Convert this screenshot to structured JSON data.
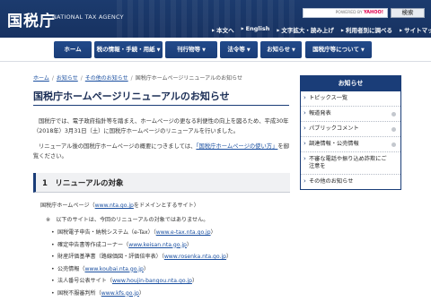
{
  "header": {
    "logo": "国税庁",
    "agency": "NATIONAL TAX AGENCY",
    "search": {
      "powered": "POWERED BY",
      "brand": "YAHOO!",
      "button": "検索"
    },
    "utility": [
      "本文へ",
      "English",
      "文字拡大・読み上げ",
      "利用者別に調べる",
      "サイトマップ"
    ]
  },
  "nav": [
    {
      "label": "ホーム",
      "has_dropdown": false
    },
    {
      "label": "税の情報・手続・用紙",
      "has_dropdown": true
    },
    {
      "label": "刊行物等",
      "has_dropdown": true
    },
    {
      "label": "法令等",
      "has_dropdown": true
    },
    {
      "label": "お知らせ",
      "has_dropdown": true
    },
    {
      "label": "国税庁等について",
      "has_dropdown": true
    }
  ],
  "breadcrumb": [
    "ホーム",
    "お知らせ",
    "その他のお知らせ",
    "国税庁ホームページリニューアルのお知らせ"
  ],
  "page_title": "国税庁ホームページリニューアルのお知らせ",
  "intro": {
    "p1": "国税庁では、電子政府指針等を踏まえ、ホームページの更なる利便性の向上を図るため、平成30年（2018年）3月31日（土）に国税庁ホームページのリニューアルを行いました。",
    "p2_before": "リニューアル後の国税庁ホームページの概要につきましては、",
    "p2_link": "「国税庁ホームページの使い方」",
    "p2_after": "を御覧ください。"
  },
  "section1": {
    "heading": "1　リニューアルの対象",
    "line1_before": "国税庁ホームページ（",
    "line1_link": "www.nta.go.jp",
    "line1_after": "をドメインとするサイト）",
    "note": "※　以下のサイトは、今回のリニューアルの対象ではありません。",
    "sites": [
      {
        "name": "国税電子申告・納税システム（e-Tax）",
        "url": "www.e-tax.nta.go.jp"
      },
      {
        "name": "確定申告書等作成コーナー",
        "url": "www.keisan.nta.go.jp"
      },
      {
        "name": "財産評価基準書（路線価図・評価倍率表）",
        "url": "www.rosenka.nta.go.jp"
      },
      {
        "name": "公売情報",
        "url": "www.koubai.nta.go.jp"
      },
      {
        "name": "法人番号公表サイト",
        "url": "www.houjin-bangou.nta.go.jp"
      },
      {
        "name": "国税不服審判所",
        "url": "www.kfs.go.jp"
      }
    ]
  },
  "sidebar": {
    "heading": "お知らせ",
    "items": [
      {
        "label": "トピックス一覧",
        "icon": false
      },
      {
        "label": "報道発表",
        "icon": true
      },
      {
        "label": "パブリックコメント",
        "icon": true
      },
      {
        "label": "調達情報・公売情報",
        "icon": true
      },
      {
        "label": "不審な電話や振り込め詐欺にご注意を",
        "icon": false
      },
      {
        "label": "その他のお知らせ",
        "icon": false
      }
    ]
  },
  "colors": {
    "header": "#1c3b6e",
    "nav": "#224a8b",
    "link": "#1a4fa0",
    "sidebar_head": "#1a3d78"
  }
}
